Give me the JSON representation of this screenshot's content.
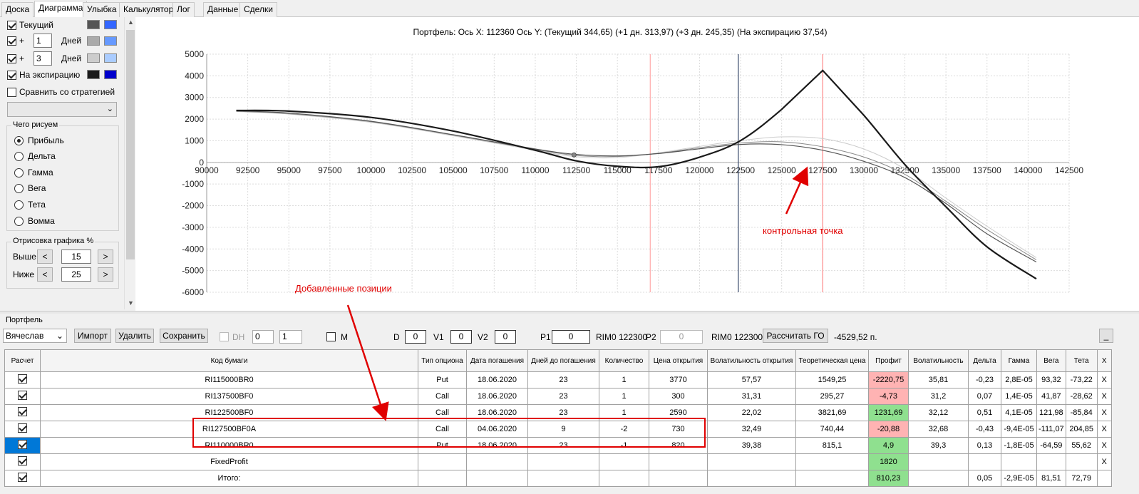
{
  "tabs": [
    "Доска",
    "Диаграмма",
    "Улыбка",
    "Калькулятор",
    "Лог",
    "Данные",
    "Сделки"
  ],
  "active_tab": "Диаграмма",
  "left_panel": {
    "current_label": "Текущий",
    "plus1": {
      "sign": "+",
      "days": "1",
      "unit": "Дней"
    },
    "plus3": {
      "sign": "+",
      "days": "3",
      "unit": "Дней"
    },
    "expiration_label": "На экспирацию",
    "compare_label": "Сравнить со стратегией",
    "swatches": {
      "current": [
        "#555555",
        "#3366ff"
      ],
      "plus1": [
        "#aaaaaa",
        "#6699ff"
      ],
      "plus3": [
        "#cccccc",
        "#aaccff"
      ],
      "expiration": [
        "#1a1a1a",
        "#0000cc"
      ]
    },
    "draw_group_title": "Чего рисуем",
    "draw_options": [
      "Прибыль",
      "Дельта",
      "Гамма",
      "Вега",
      "Тета",
      "Вомма"
    ],
    "draw_selected": "Прибыль",
    "render_group_title": "Отрисовка графика %",
    "above_label": "Выше",
    "above_value": "15",
    "below_label": "Ниже",
    "below_value": "25",
    "btn_prev": "<",
    "btn_next": ">"
  },
  "chart": {
    "header": "Портфель: Ось X: 112360 Ось Y:  (Текущий 344,65)  (+1 дн. 313,97)  (+3 дн. 245,35)  (На экспирацию 37,54)",
    "annotation": "контрольная точка"
  },
  "chart_data": {
    "type": "line",
    "title": "Портфель: Ось X: 112360 Ось Y:  (Текущий 344,65)  (+1 дн. 313,97)  (+3 дн. 245,35)  (На экспирацию 37,54)",
    "xlim": [
      90000,
      142500
    ],
    "ylim": [
      -6000,
      5000
    ],
    "x_ticks": [
      "90000",
      "92500",
      "95000",
      "97500",
      "100000",
      "102500",
      "105000",
      "107500",
      "110000",
      "112500",
      "115000",
      "117500",
      "120000",
      "122500",
      "125000",
      "127500",
      "130000",
      "132500",
      "135000",
      "137500",
      "140000",
      "142500"
    ],
    "y_ticks": [
      "5000",
      "4000",
      "3000",
      "2000",
      "1000",
      "0",
      "-1000",
      "-2000",
      "-3000",
      "-4000",
      "-5000",
      "-6000"
    ],
    "grid": true,
    "vertical_markers": [
      {
        "x": 117000,
        "color": "#ffaaaa"
      },
      {
        "x": 122360,
        "color": "#334466"
      },
      {
        "x": 127500,
        "color": "#ff8888"
      }
    ],
    "series": [
      {
        "color": "#1a1a1a",
        "width": 2.2,
        "x": [
          91800,
          95000,
          100000,
          105000,
          110000,
          112500,
          115000,
          117500,
          120000,
          122500,
          125000,
          127500,
          130000,
          132500,
          135000,
          137500,
          140500
        ],
        "y": [
          2400,
          2370,
          2080,
          1450,
          560,
          70,
          -180,
          -200,
          240,
          1010,
          2450,
          4250,
          2180,
          -100,
          -2050,
          -3900,
          -5380
        ]
      },
      {
        "color": "#555555",
        "width": 1.2,
        "x": [
          91800,
          95000,
          100000,
          105000,
          110000,
          112500,
          115000,
          117500,
          120000,
          122500,
          125000,
          127500,
          130000,
          132500,
          135000,
          137500,
          140500
        ],
        "y": [
          2380,
          2280,
          1900,
          1280,
          620,
          370,
          300,
          410,
          630,
          830,
          820,
          560,
          50,
          -700,
          -1900,
          -3300,
          -4600
        ]
      },
      {
        "color": "#888888",
        "width": 1.0,
        "x": [
          91800,
          95000,
          100000,
          105000,
          110000,
          112500,
          115000,
          117500,
          120000,
          122500,
          125000,
          127500,
          130000,
          132500,
          135000,
          137500,
          140500
        ],
        "y": [
          2360,
          2250,
          1880,
          1260,
          600,
          320,
          270,
          420,
          680,
          900,
          950,
          720,
          250,
          -550,
          -1800,
          -3100,
          -4500
        ]
      },
      {
        "color": "#cccccc",
        "width": 1.0,
        "x": [
          91800,
          95000,
          100000,
          105000,
          110000,
          112500,
          115000,
          117500,
          120000,
          122500,
          125000,
          127500,
          130000,
          132500,
          135000,
          137500,
          140500
        ],
        "y": [
          2350,
          2230,
          1850,
          1230,
          560,
          260,
          220,
          440,
          740,
          1010,
          1180,
          1100,
          620,
          -300,
          -1650,
          -2950,
          -4400
        ]
      }
    ],
    "points": [
      {
        "x": 112360,
        "y": 344.65
      }
    ]
  },
  "portfolio": {
    "group_label": "Портфель",
    "account": "Вячеслав",
    "import_btn": "Импорт",
    "delete_btn": "Удалить",
    "save_btn": "Сохранить",
    "dh_label": "DH",
    "dh_v1": "0",
    "dh_v2": "1",
    "m_label": "M",
    "d_label": "D",
    "d_value": "0",
    "v1_label": "V1",
    "v1_value": "0",
    "v2_label": "V2",
    "v2_value": "0",
    "p1_label": "P1",
    "p1_value": "0",
    "rim1": "RIM0 122300",
    "p2_label": "P2",
    "p2_value": "0",
    "rim2": "RIM0 122300",
    "calc_go_btn": "Рассчитать ГО",
    "go_value": "-4529,52 п.",
    "minimize_btn": "_",
    "annotation": "Добавленные позиции"
  },
  "table": {
    "headers": [
      "Расчет",
      "Код бумаги",
      "Тип опциона",
      "Дата погашения",
      "Дней до погашения",
      "Количество",
      "Цена открытия",
      "Волатильность открытия",
      "Теоретическая цена",
      "Профит",
      "Волатильность",
      "Дельта",
      "Гамма",
      "Вега",
      "Тета",
      "X"
    ],
    "rows": [
      {
        "check": true,
        "code": "RI115000BR0",
        "type": "Put",
        "date": "18.06.2020",
        "days": "23",
        "qty": "1",
        "open": "3770",
        "vol_open": "57,57",
        "theo": "1549,25",
        "profit": "-2220,75",
        "profit_sign": "neg",
        "vol": "35,81",
        "delta": "-0,23",
        "gamma": "2,8E-05",
        "vega": "93,32",
        "theta": "-73,22",
        "x": "X"
      },
      {
        "check": true,
        "code": "RI137500BF0",
        "type": "Call",
        "date": "18.06.2020",
        "days": "23",
        "qty": "1",
        "open": "300",
        "vol_open": "31,31",
        "theo": "295,27",
        "profit": "-4,73",
        "profit_sign": "neg",
        "vol": "31,2",
        "delta": "0,07",
        "gamma": "1,4E-05",
        "vega": "41,87",
        "theta": "-28,62",
        "x": "X"
      },
      {
        "check": true,
        "code": "RI122500BF0",
        "type": "Call",
        "date": "18.06.2020",
        "days": "23",
        "qty": "1",
        "open": "2590",
        "vol_open": "22,02",
        "theo": "3821,69",
        "profit": "1231,69",
        "profit_sign": "pos",
        "vol": "32,12",
        "delta": "0,51",
        "gamma": "4,1E-05",
        "vega": "121,98",
        "theta": "-85,84",
        "x": "X"
      },
      {
        "check": true,
        "code": "RI127500BF0A",
        "type": "Call",
        "date": "04.06.2020",
        "days": "9",
        "qty": "-2",
        "open": "730",
        "vol_open": "32,49",
        "theo": "740,44",
        "profit": "-20,88",
        "profit_sign": "neg",
        "vol": "32,68",
        "delta": "-0,43",
        "gamma": "-9,4E-05",
        "vega": "-111,07",
        "theta": "204,85",
        "x": "X"
      },
      {
        "check": true,
        "code": "RI110000BR0",
        "type": "Put",
        "date": "18.06.2020",
        "days": "23",
        "qty": "-1",
        "open": "820",
        "vol_open": "39,38",
        "theo": "815,1",
        "profit": "4,9",
        "profit_sign": "pos",
        "vol": "39,3",
        "delta": "0,13",
        "gamma": "-1,8E-05",
        "vega": "-64,59",
        "theta": "55,62",
        "x": "X",
        "selected": true
      },
      {
        "check": true,
        "code": "FixedProfit",
        "type": "",
        "date": "",
        "days": "",
        "qty": "",
        "open": "",
        "vol_open": "",
        "theo": "",
        "profit": "1820",
        "profit_sign": "pos",
        "vol": "",
        "delta": "",
        "gamma": "",
        "vega": "",
        "theta": "",
        "x": "X"
      },
      {
        "check": true,
        "code": "Итого:",
        "type": "",
        "date": "",
        "days": "",
        "qty": "",
        "open": "",
        "vol_open": "",
        "theo": "",
        "profit": "810,23",
        "profit_sign": "pos",
        "vol": "",
        "delta": "0,05",
        "gamma": "-2,9E-05",
        "vega": "81,51",
        "theta": "72,79",
        "x": ""
      }
    ]
  }
}
